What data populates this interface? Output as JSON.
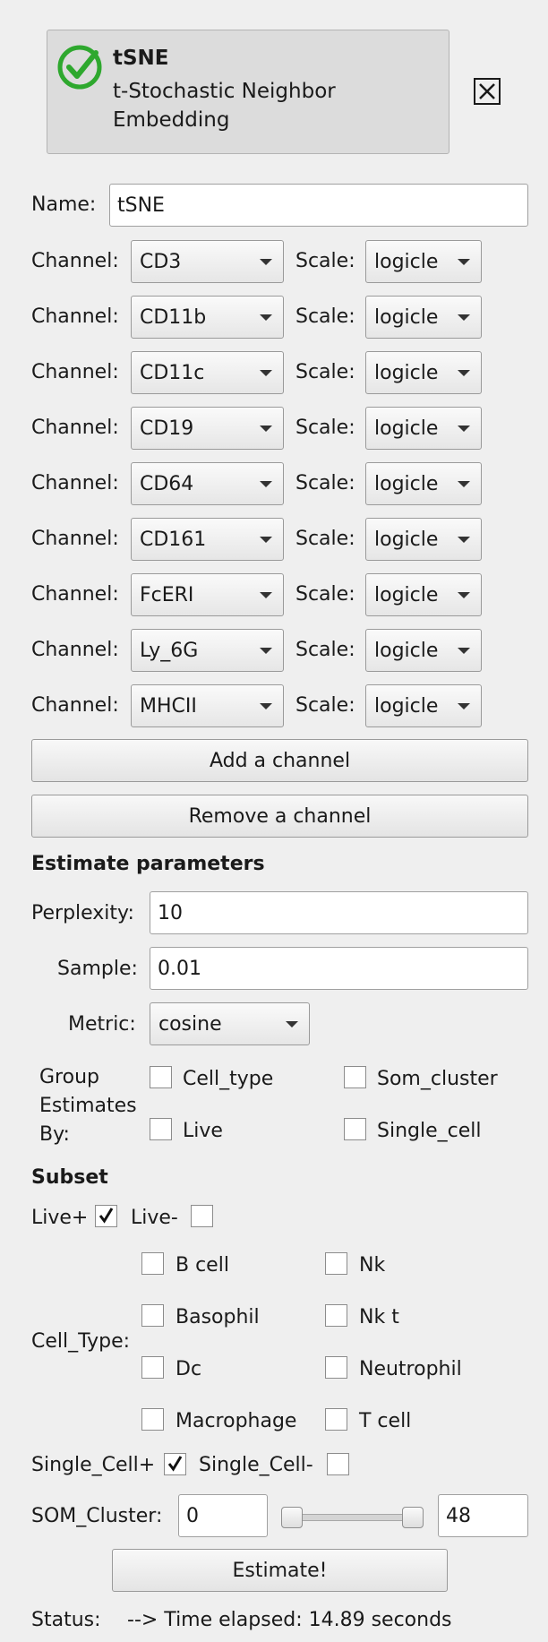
{
  "header": {
    "name": "tSNE",
    "description": "t-Stochastic Neighbor Embedding",
    "icon": "green-check-circle-icon",
    "close_icon": "close-icon"
  },
  "name_field": {
    "label": "Name:",
    "value": "tSNE"
  },
  "channels": {
    "channel_label": "Channel:",
    "scale_label": "Scale:",
    "rows": [
      {
        "channel": "CD3",
        "scale": "logicle"
      },
      {
        "channel": "CD11b",
        "scale": "logicle"
      },
      {
        "channel": "CD11c",
        "scale": "logicle"
      },
      {
        "channel": "CD19",
        "scale": "logicle"
      },
      {
        "channel": "CD64",
        "scale": "logicle"
      },
      {
        "channel": "CD161",
        "scale": "logicle"
      },
      {
        "channel": "FcERI",
        "scale": "logicle"
      },
      {
        "channel": "Ly_6G",
        "scale": "logicle"
      },
      {
        "channel": "MHCII",
        "scale": "logicle"
      }
    ],
    "add_label": "Add a channel",
    "remove_label": "Remove a channel"
  },
  "estimate": {
    "title": "Estimate parameters",
    "perplexity_label": "Perplexity:",
    "perplexity_value": "10",
    "sample_label": "Sample:",
    "sample_value": "0.01",
    "metric_label": "Metric:",
    "metric_value": "cosine",
    "group_label_1": "Group",
    "group_label_2": "Estimates",
    "group_label_3": "By:",
    "group_options": [
      {
        "label": "Cell_type",
        "checked": false
      },
      {
        "label": "Som_cluster",
        "checked": false
      },
      {
        "label": "Live",
        "checked": false
      },
      {
        "label": "Single_cell",
        "checked": false
      }
    ]
  },
  "subset": {
    "title": "Subset",
    "live_plus": {
      "label": "Live+",
      "checked": true
    },
    "live_minus": {
      "label": "Live-",
      "checked": false
    },
    "cell_type_label": "Cell_Type:",
    "cell_types": [
      {
        "label": "B cell",
        "checked": false
      },
      {
        "label": "Nk",
        "checked": false
      },
      {
        "label": "Basophil",
        "checked": false
      },
      {
        "label": "Nk t",
        "checked": false
      },
      {
        "label": "Dc",
        "checked": false
      },
      {
        "label": "Neutrophil",
        "checked": false
      },
      {
        "label": "Macrophage",
        "checked": false
      },
      {
        "label": "T cell",
        "checked": false
      }
    ],
    "single_plus": {
      "label": "Single_Cell+",
      "checked": true
    },
    "single_minus": {
      "label": "Single_Cell-",
      "checked": false
    },
    "som_label": "SOM_Cluster:",
    "som_min": "0",
    "som_max": "48"
  },
  "estimate_button": "Estimate!",
  "status": {
    "label": "Status:",
    "text": "--> Time elapsed: 14.89 seconds"
  },
  "colors": {
    "background": "#efefef",
    "check_green": "#2ea82e"
  }
}
